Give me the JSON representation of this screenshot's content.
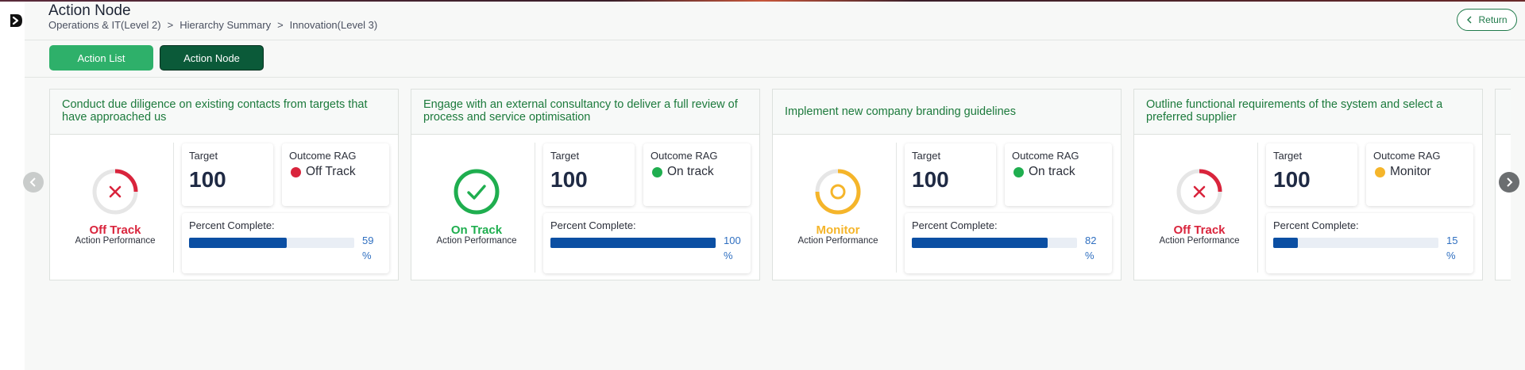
{
  "header": {
    "title": "Action Node",
    "breadcrumb": [
      "Operations & IT(Level 2)",
      "Hierarchy Summary",
      "Innovation(Level 3)"
    ],
    "return_label": "Return"
  },
  "tabs": {
    "action_list": "Action List",
    "action_node": "Action Node"
  },
  "card_labels": {
    "target": "Target",
    "outcome_rag": "Outcome RAG",
    "percent_complete": "Percent Complete:",
    "performance_caption": "Action Performance"
  },
  "colors": {
    "red": "#d9243c",
    "green": "#1fae4f",
    "amber": "#f5b52a",
    "brand_green": "#1f7a4a"
  },
  "cards": [
    {
      "title": "Conduct due diligence on existing contacts from targets that have approached us",
      "performance": "Off Track",
      "performance_icon": "x-icon",
      "target": "100",
      "outcome_rag": "Off Track",
      "rag_color": "red",
      "percent": 59,
      "percent_text": "59",
      "percent_unit": "%"
    },
    {
      "title": "Engage with an external consultancy to deliver a full review of process and service optimisation",
      "performance": "On Track",
      "performance_icon": "check-icon",
      "target": "100",
      "outcome_rag": "On track",
      "rag_color": "green",
      "percent": 100,
      "percent_text": "100",
      "percent_unit": "%"
    },
    {
      "title": "Implement new company branding guidelines",
      "performance": "Monitor",
      "performance_icon": "circle-icon",
      "target": "100",
      "outcome_rag": "On track",
      "rag_color": "green",
      "percent": 82,
      "percent_text": "82",
      "percent_unit": "%"
    },
    {
      "title": "Outline functional requirements of the system and select a preferred supplier",
      "performance": "Off Track",
      "performance_icon": "x-icon",
      "target": "100",
      "outcome_rag": "Monitor",
      "rag_color": "amber",
      "percent": 15,
      "percent_text": "15",
      "percent_unit": "%"
    }
  ]
}
